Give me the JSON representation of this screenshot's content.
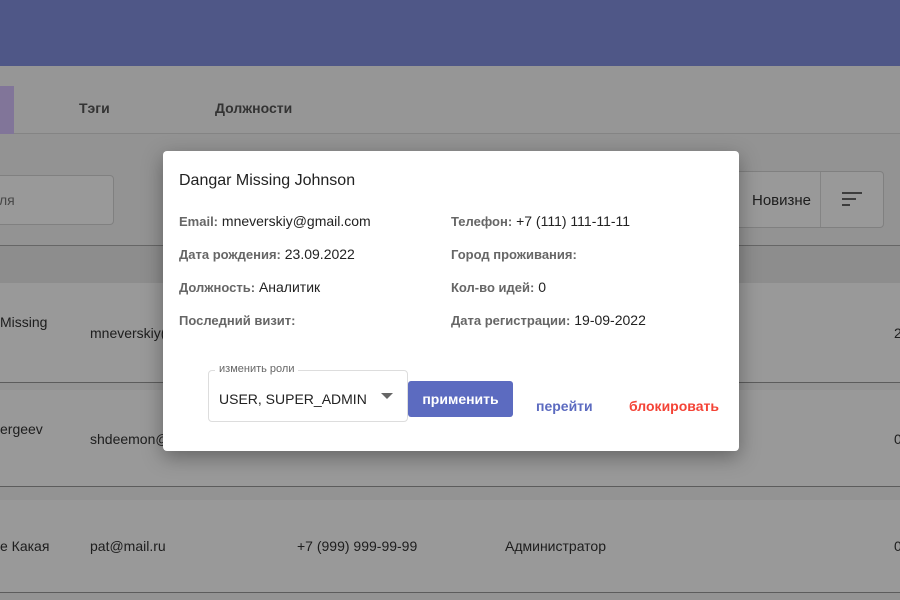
{
  "tabs": {
    "tags": "Тэги",
    "positions": "Должности"
  },
  "search": {
    "placeholder_partial": "ля"
  },
  "sort": {
    "label": "Новизне"
  },
  "rows": [
    {
      "name": "Missing",
      "email": "mneverskiy(",
      "extra": "2"
    },
    {
      "name": "ergeev",
      "email": "shdeemon@",
      "extra": "0"
    },
    {
      "name": "e Какая",
      "email": "pat@mail.ru",
      "phone": "+7 (999) 999-99-99",
      "role": "Администратор",
      "extra": "0"
    }
  ],
  "modal": {
    "title": "Dangar Missing Johnson",
    "email_label": "Email:",
    "email": "mneverskiy@gmail.com",
    "birth_label": "Дата рождения:",
    "birth": "23.09.2022",
    "position_label": "Должность:",
    "position": "Аналитик",
    "visit_label": "Последний визит:",
    "phone_label": "Телефон:",
    "phone": "+7 (111) 111-11-11",
    "city_label": "Город проживания:",
    "ideas_label": "Кол-во идей:",
    "ideas": "0",
    "reg_label": "Дата регистрации:",
    "reg": "19-09-2022",
    "roles_legend": "изменить роли",
    "roles_value": "USER, SUPER_ADMIN",
    "apply": "применить",
    "go": "перейти",
    "block": "блокировать"
  }
}
